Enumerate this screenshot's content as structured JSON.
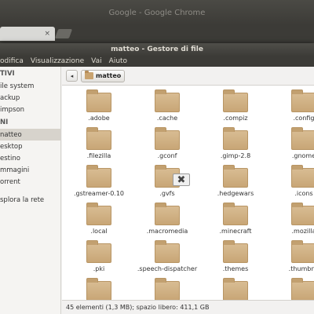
{
  "chrome": {
    "title": "Google - Google Chrome",
    "tab_close": "×"
  },
  "nautilus": {
    "title": "matteo - Gestore di file",
    "menu": [
      "odifica",
      "Visualizzazione",
      "Vai",
      "Aiuto"
    ],
    "sidebar": {
      "heading_devices": "TIVI",
      "devices": [
        "ile system",
        "ackup",
        "impson"
      ],
      "heading_places": "NI",
      "places": [
        {
          "label": "natteo",
          "selected": true
        },
        {
          "label": "esktop",
          "selected": false
        },
        {
          "label": "estino",
          "selected": false
        },
        {
          "label": "mmagini",
          "selected": false
        },
        {
          "label": "orrent",
          "selected": false
        }
      ],
      "network": "splora la rete"
    },
    "pathbar": {
      "back_icon": "◂",
      "crumb": "matteo"
    },
    "folders": [
      [
        ".adobe",
        ".cache",
        ".compiz",
        ".config"
      ],
      [
        ".filezilla",
        ".gconf",
        ".gimp-2.8",
        ".gnome"
      ],
      [
        ".gstreamer-0.10",
        ".gvfs",
        ".hedgewars",
        ".icons"
      ],
      [
        ".local",
        ".macromedia",
        ".minecraft",
        ".mozilla"
      ],
      [
        ".pki",
        ".speech-dispatcher",
        ".themes",
        ".thumbna"
      ]
    ],
    "drag_cursor": "✖",
    "status": "45 elementi (1,3 MB); spazio libero: 411,1 GB"
  }
}
